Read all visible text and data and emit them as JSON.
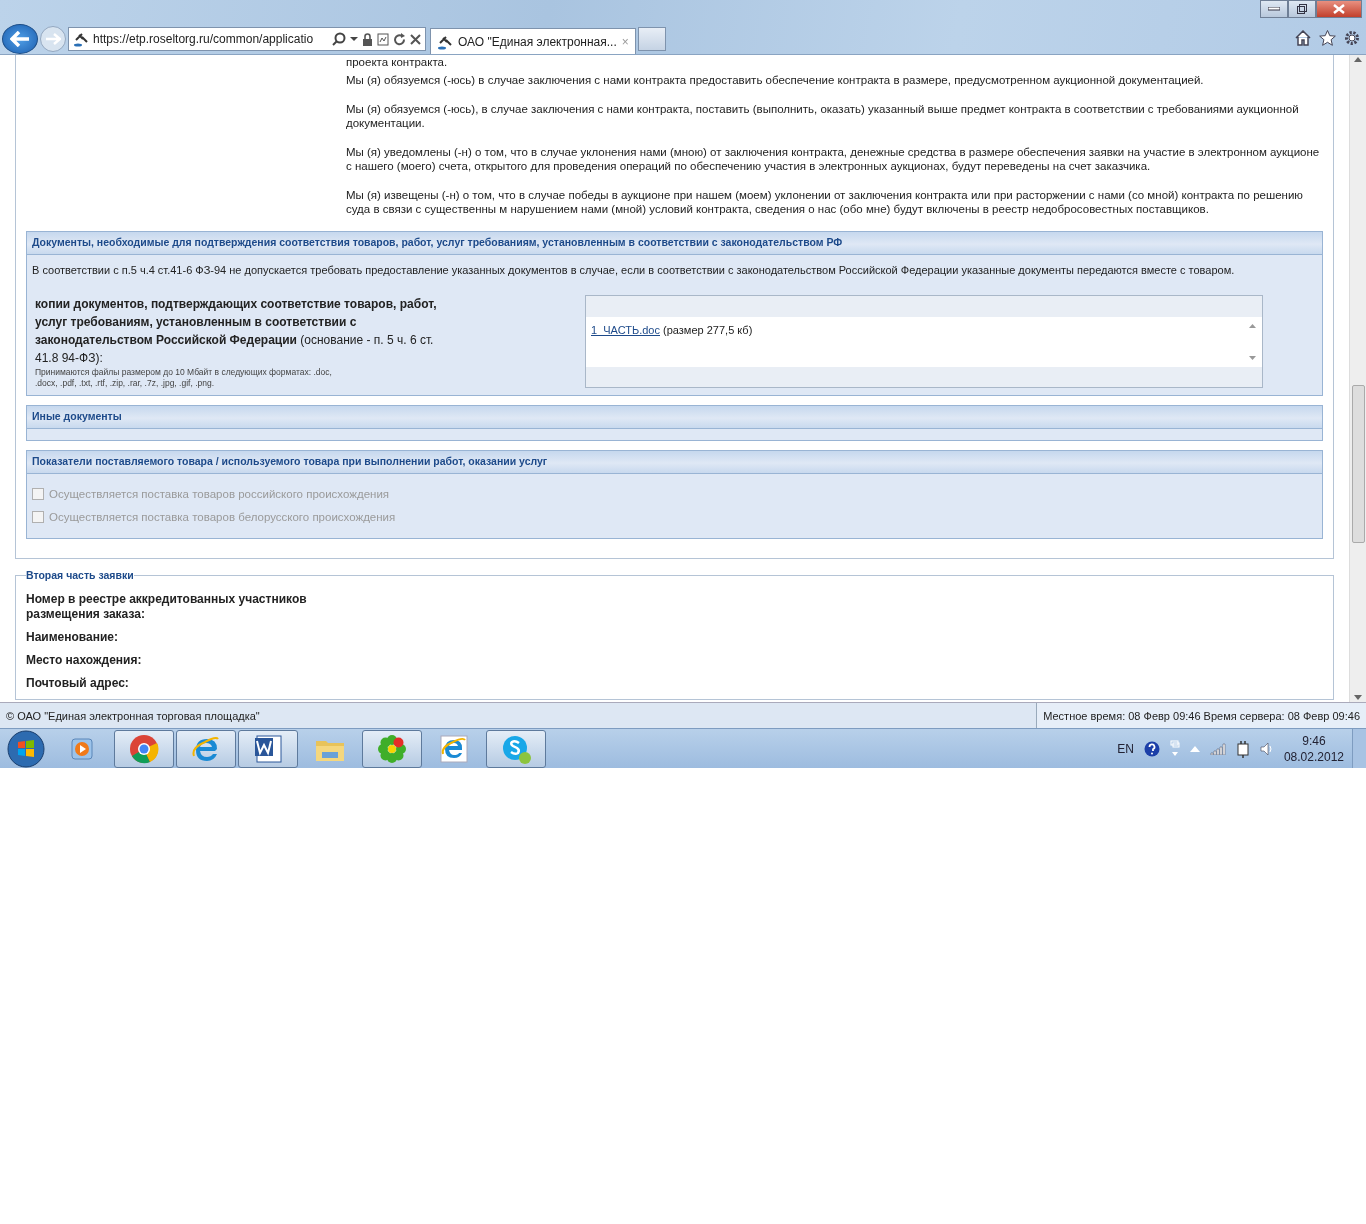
{
  "browser": {
    "address": "https://etp.roseltorg.ru/common/applicatio",
    "tabs": [
      {
        "label": "ОАО \"Единая электронная...",
        "selected": true
      }
    ],
    "tab_close": "×"
  },
  "intro_paragraphs": [
    "проекта контракта.",
    "Мы (я) обязуемся (-юсь) в случае заключения с нами контракта предоставить обеспечение контракта в размере, предусмотренном аукционной документацией.",
    "Мы (я) обязуемся (-юсь), в случае заключения с нами контракта, поставить (выполнить, оказать) указанный выше предмет контракта в соответствии с требованиями аукционной документации.",
    "Мы (я) уведомлены (-н) о том, что в случае уклонения нами (мною) от заключения контракта, денежные средства в размере обеспечения заявки на участие в электронном аукционе с нашего (моего) счета, открытого для проведения операций по обеспечению участия в электронных аукционах, будут переведены на счет заказчика.",
    "Мы (я) извещены (-н) о том, что в случае победы в аукционе при нашем (моем) уклонении от заключения контракта или при расторжении с нами (со мной) контракта по решению суда в связи с существенны м нарушением нами (мной) условий контракта, сведения о нас (обо мне) будут включены в реестр недобросовестных поставщиков."
  ],
  "documents_panel": {
    "title": "Документы, необходимые для подтверждения соответствия товаров, работ, услуг требованиям, установленным в соответствии с законодательством РФ",
    "note": "В соответствии с п.5 ч.4 ст.41-6 ФЗ-94 не допускается требовать предоставление указанных документов в случае, если в соответствии с законодательством Российской Федерации указанные документы передаются вместе с товаром.",
    "field_label": "**копии документов, подтверждающих соответствие товаров, работ, услуг требованиям, установленным в соответствии с законодательством Российской Федерации** (основание - п. 5 ч. 6 ст. 41.8 94-ФЗ):",
    "field_hint": "Принимаются файлы размером до 10 Мбайт в следующих форматах: .doc, .docx, .pdf, .txt, .rtf, .zip, .rar, .7z, .jpg, .gif, .png.",
    "files": [
      {
        "name": "1_ЧАСТЬ.doc",
        "size": "(размер 277,5 кб)"
      }
    ]
  },
  "other_panel": {
    "title": "Иные документы"
  },
  "goods_panel": {
    "title": "Показатели поставляемого товара / используемого товара при выполнении работ, оказании услуг",
    "options": [
      {
        "label": "Осуществляется поставка товаров российского происхождения",
        "checked": false,
        "disabled": true
      },
      {
        "label": "Осуществляется поставка товаров белорусского происхождения",
        "checked": false,
        "disabled": true
      }
    ]
  },
  "second_part": {
    "title": "Вторая часть заявки",
    "fields": [
      "Номер в реестре аккредитованных участников размещения заказа:",
      "Наименование:",
      "Место нахождения:",
      "Почтовый адрес:"
    ]
  },
  "status_bar": {
    "copyright": "© ОАО \"Единая электронная торговая площадка\"",
    "time": "Местное время: 08 Февр 09:46 Время сервера: 08 Февр 09:46"
  },
  "taskbar": {
    "apps": [
      {
        "kind": "player",
        "open": false
      },
      {
        "kind": "chrome",
        "open": true
      },
      {
        "kind": "ie",
        "open": true
      },
      {
        "kind": "word",
        "open": true
      },
      {
        "kind": "folder",
        "open": false
      },
      {
        "kind": "flower",
        "open": true
      },
      {
        "kind": "ie2",
        "open": false
      },
      {
        "kind": "skype",
        "open": true
      }
    ],
    "language": "EN",
    "clock_time": "9:46",
    "clock_date": "08.02.2012"
  }
}
